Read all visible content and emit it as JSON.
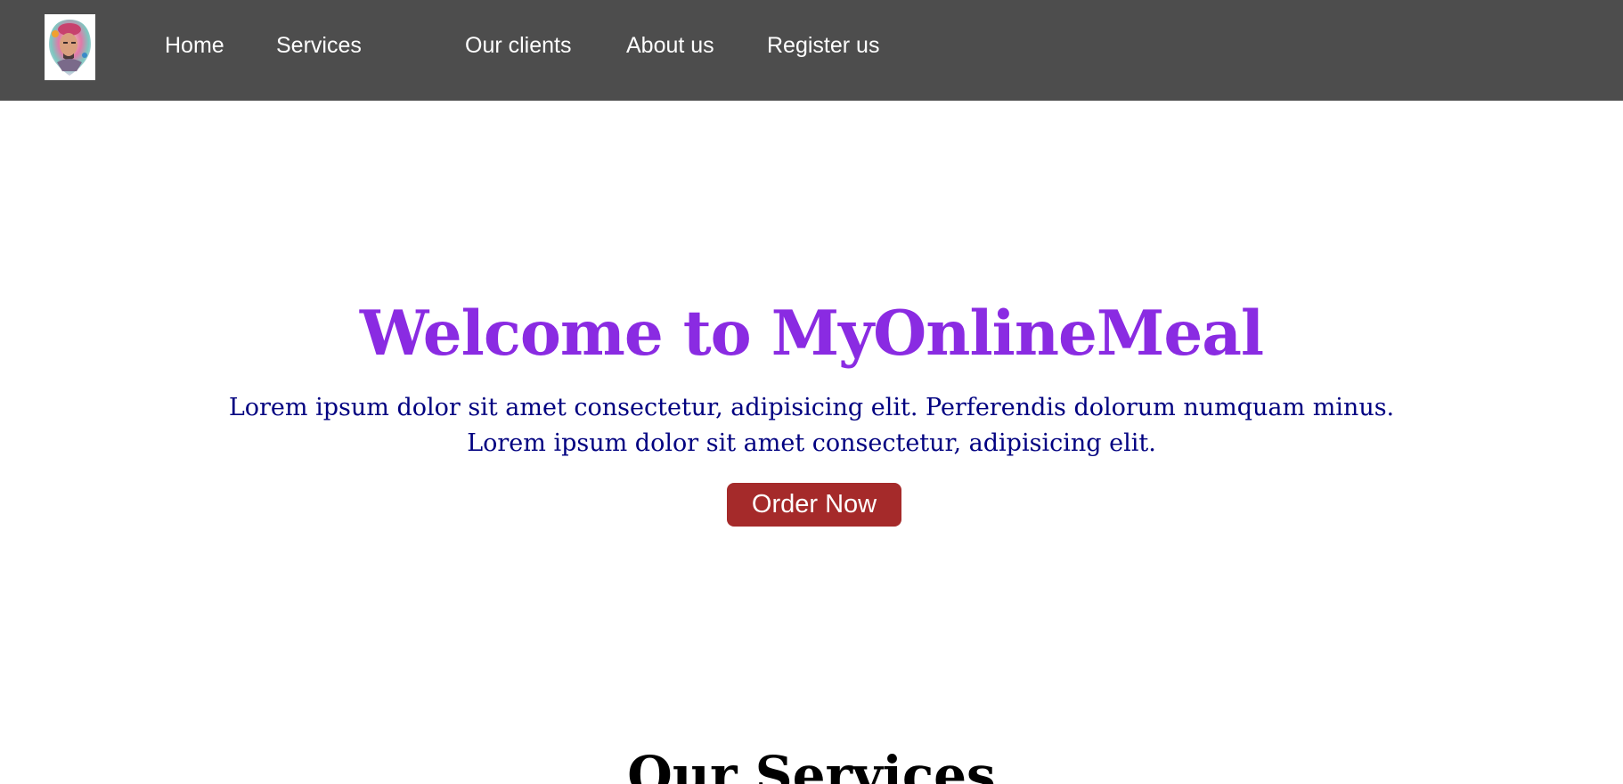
{
  "navbar": {
    "logo_icon": "profile-avatar-logo",
    "background": "#4d4d4d",
    "links": [
      {
        "label": "Home"
      },
      {
        "label": "Services"
      },
      {
        "label": "Our clients"
      },
      {
        "label": "About us"
      },
      {
        "label": "Register us"
      }
    ]
  },
  "hero": {
    "title": "Welcome to MyOnlineMeal",
    "title_color": "#8a2be2",
    "text_line1": "Lorem ipsum dolor sit amet consectetur, adipisicing elit. Perferendis dolorum numquam minus.",
    "text_line2": "Lorem ipsum dolor sit amet consectetur, adipisicing elit.",
    "text_color": "#000080",
    "button_label": "Order Now",
    "button_color": "#a52a2a"
  },
  "services": {
    "title": "Our Services"
  }
}
